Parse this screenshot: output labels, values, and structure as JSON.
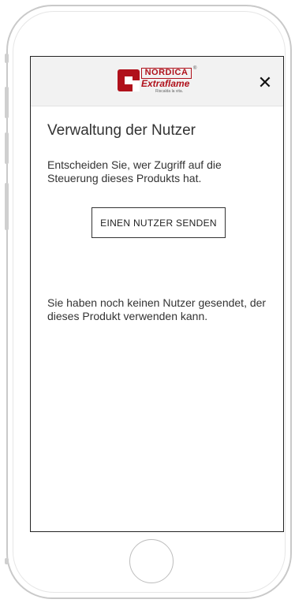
{
  "brand": {
    "logo_top": "NORDICA",
    "logo_name": "Extraflame",
    "tagline": "Riscalda la vita.",
    "registered": "®",
    "color": "#b0111b"
  },
  "header": {
    "close_label": "✕"
  },
  "page": {
    "title": "Verwaltung der Nutzer",
    "description": "Entscheiden Sie, wer Zugriff auf die Steuerung dieses Produkts hat.",
    "send_button": "EINEN NUTZER SENDEN",
    "empty_message": "Sie haben noch keinen Nutzer gesendet, der dieses Produkt verwenden kann."
  }
}
